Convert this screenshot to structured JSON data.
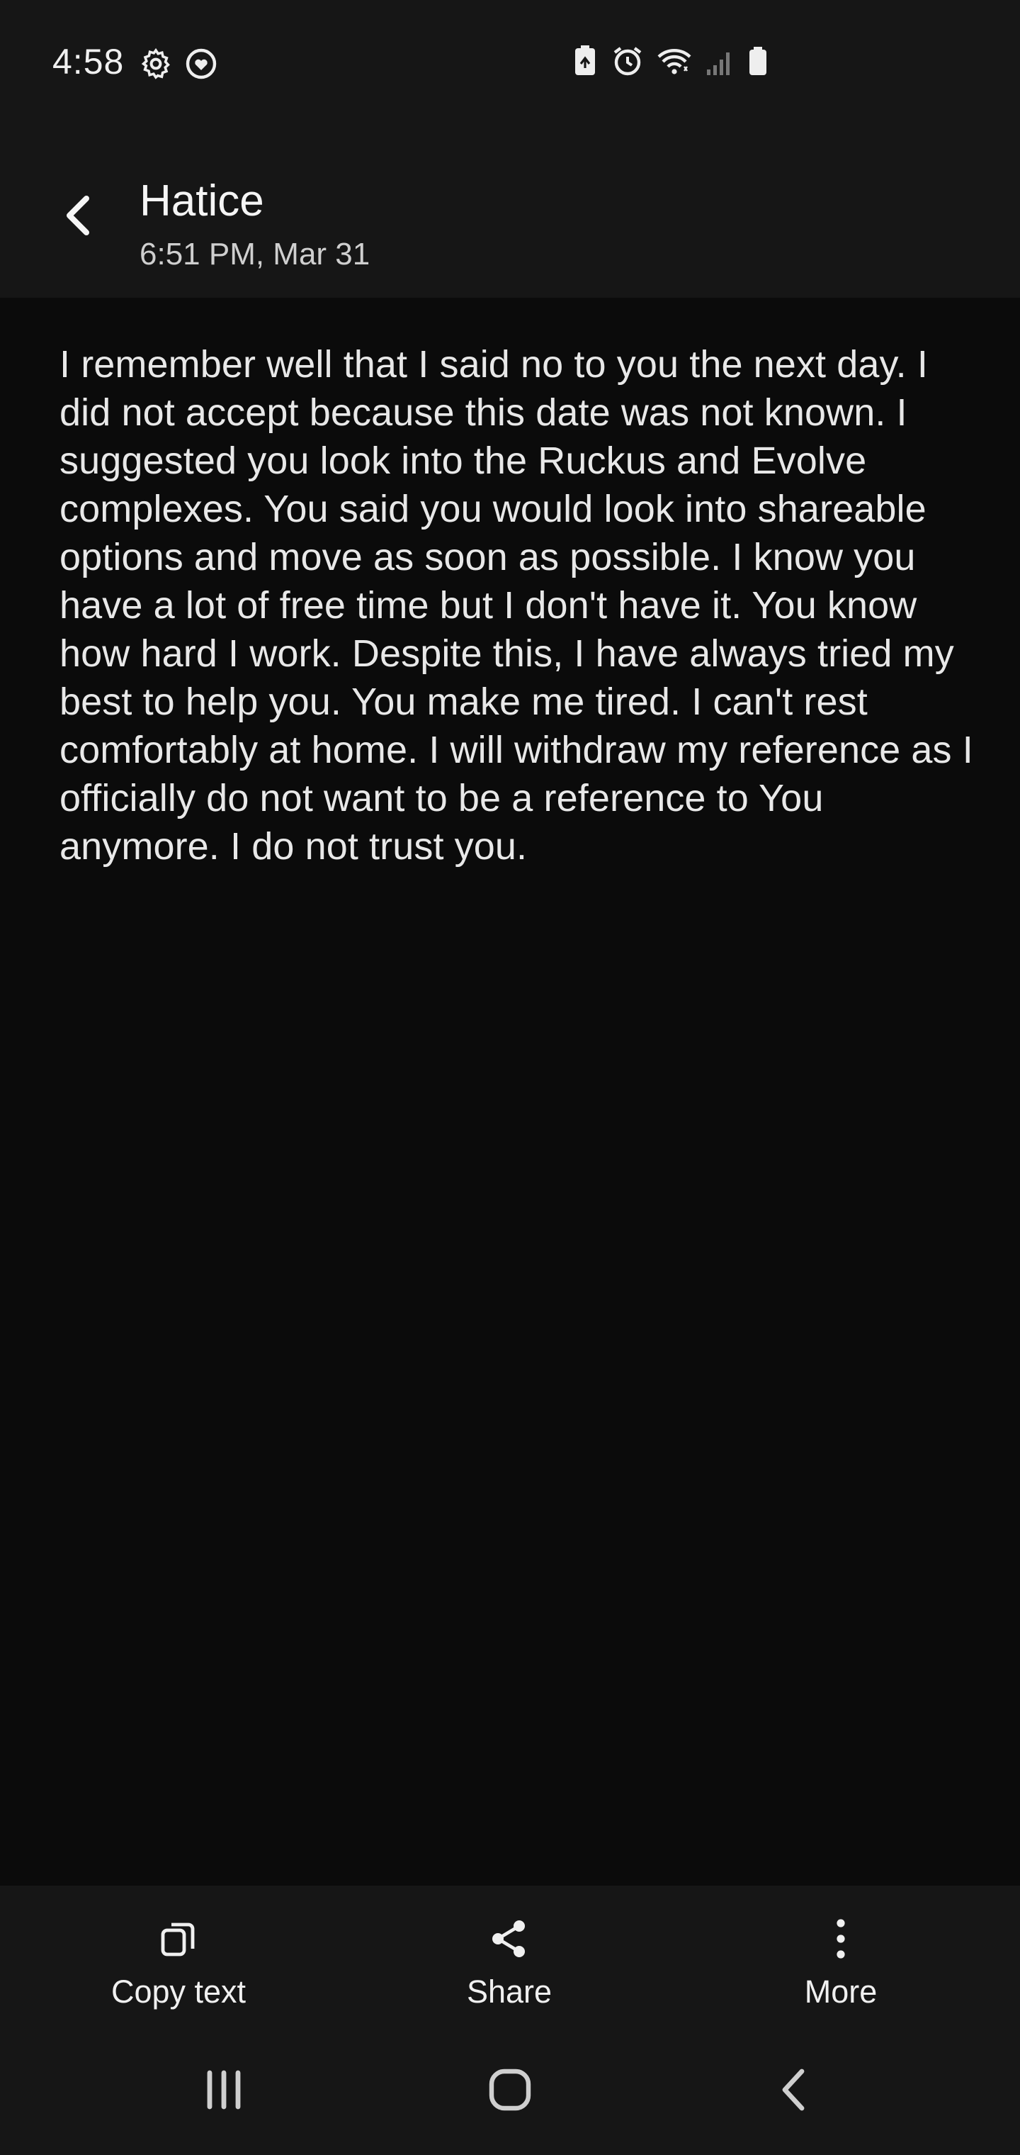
{
  "status_bar": {
    "time": "4:58",
    "left_icons": [
      "settings-icon",
      "heart-shield-icon"
    ],
    "right_icons": [
      "battery-saver-icon",
      "alarm-icon",
      "wifi-icon",
      "signal-icon",
      "battery-icon"
    ]
  },
  "header": {
    "sender": "Hatice",
    "date": "6:51 PM, Mar 31",
    "back_icon": "chevron-left-icon"
  },
  "message": {
    "text": "I remember well that I said no to you the next day. I did not accept because this date was not known. I suggested you look into the Ruckus and Evolve complexes. You said you would look into shareable options and move as soon as possible. I know you have a lot of free time but I don't have it. You know how hard I work. Despite this, I have always tried my best to help you. You make me tired. I can't rest comfortably at home. I will withdraw my reference as I officially do not want to be a reference to You anymore. I do not trust you."
  },
  "actions": [
    {
      "label": "Copy text",
      "icon": "copy-icon"
    },
    {
      "label": "Share",
      "icon": "share-icon"
    },
    {
      "label": "More",
      "icon": "more-vertical-icon"
    }
  ],
  "nav": [
    "recent-apps-icon",
    "home-icon",
    "back-icon"
  ],
  "colors": {
    "bar_background": "#161616",
    "body_background": "#0b0b0b",
    "text": "#ececec"
  }
}
